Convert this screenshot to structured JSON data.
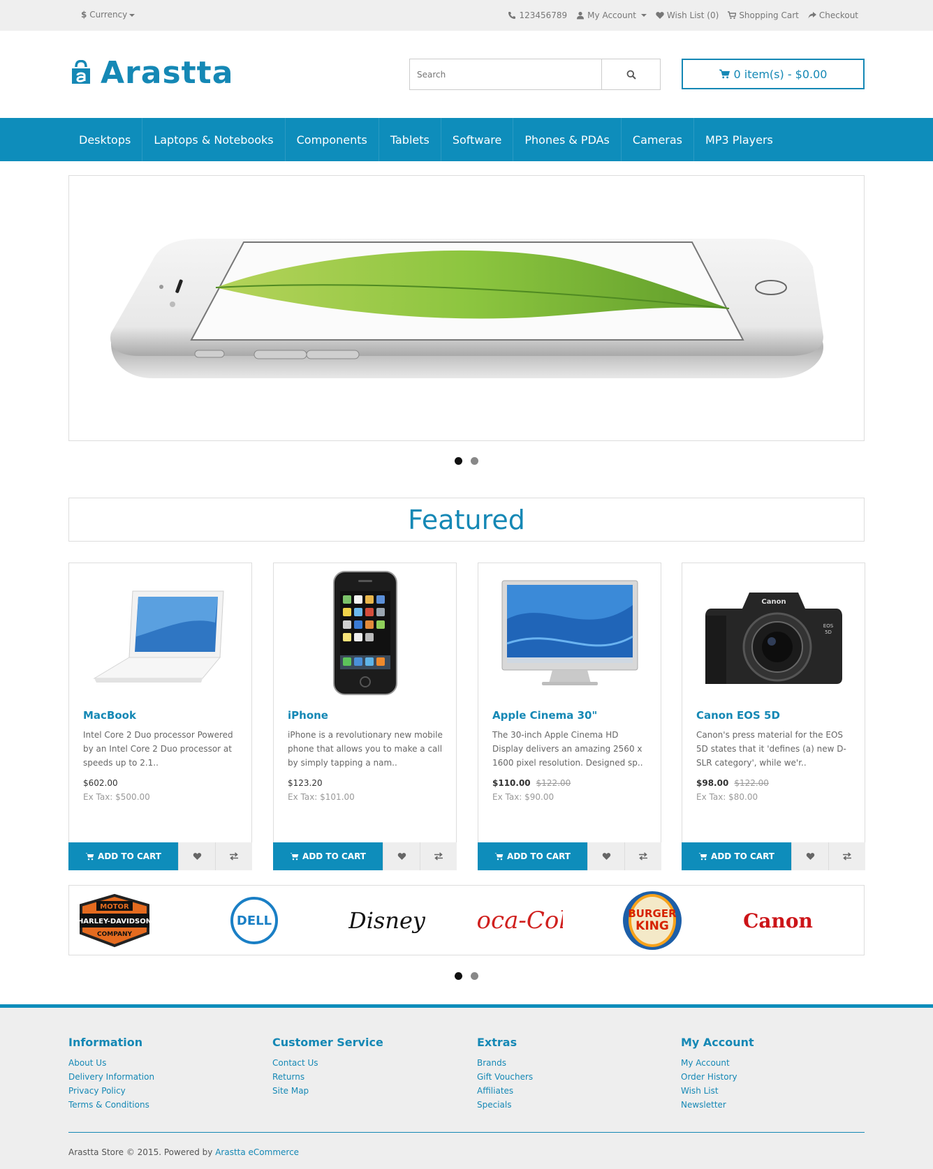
{
  "topbar": {
    "currency_symbol": "$",
    "currency_label": "Currency",
    "phone": "123456789",
    "my_account": "My Account",
    "wish_list": "Wish List (0)",
    "shopping_cart": "Shopping Cart",
    "checkout": "Checkout"
  },
  "header": {
    "logo_text": "Arastta",
    "search_placeholder": "Search",
    "cart_summary": "0 item(s) - $0.00"
  },
  "nav": {
    "items": [
      "Desktops",
      "Laptops & Notebooks",
      "Components",
      "Tablets",
      "Software",
      "Phones & PDAs",
      "Cameras",
      "MP3 Players"
    ]
  },
  "slider": {
    "slide_count": 2,
    "active_index": 0
  },
  "featured": {
    "title": "Featured",
    "products": [
      {
        "name": "MacBook",
        "description": "Intel Core 2 Duo processor Powered by an Intel Core 2 Duo processor at speeds up to 2.1..",
        "price": "$602.00",
        "old_price": "",
        "tax": "Ex Tax: $500.00",
        "add_to_cart": "ADD TO CART"
      },
      {
        "name": "iPhone",
        "description": "iPhone is a revolutionary new mobile phone that allows you to make a call by simply tapping a nam..",
        "price": "$123.20",
        "old_price": "",
        "tax": "Ex Tax: $101.00",
        "add_to_cart": "ADD TO CART"
      },
      {
        "name": "Apple Cinema 30\"",
        "description": "The 30-inch Apple Cinema HD Display delivers an amazing 2560 x 1600 pixel resolution. Designed sp..",
        "price": "$110.00",
        "old_price": "$122.00",
        "tax": "Ex Tax: $90.00",
        "add_to_cart": "ADD TO CART"
      },
      {
        "name": "Canon EOS 5D",
        "description": "Canon's press material for the EOS 5D states that it 'defines (a) new D-SLR category', while we'r..",
        "price": "$98.00",
        "old_price": "$122.00",
        "tax": "Ex Tax: $80.00",
        "add_to_cart": "ADD TO CART"
      }
    ]
  },
  "brands": {
    "items": [
      "HARLEY-DAVIDSON",
      "DELL",
      "Disney",
      "Coca-Cola",
      "BURGER KING",
      "Canon"
    ],
    "slide_count": 2,
    "active_index": 0
  },
  "footer": {
    "columns": [
      {
        "title": "Information",
        "links": [
          "About Us",
          "Delivery Information",
          "Privacy Policy",
          "Terms & Conditions"
        ]
      },
      {
        "title": "Customer Service",
        "links": [
          "Contact Us",
          "Returns",
          "Site Map"
        ]
      },
      {
        "title": "Extras",
        "links": [
          "Brands",
          "Gift Vouchers",
          "Affiliates",
          "Specials"
        ]
      },
      {
        "title": "My Account",
        "links": [
          "My Account",
          "Order History",
          "Wish List",
          "Newsletter"
        ]
      }
    ],
    "copyright": "Arastta Store © 2015. Powered by",
    "powered_by": "Arastta eCommerce"
  },
  "colors": {
    "accent": "#0e8dbb",
    "link": "#1588b5",
    "topbar_bg": "#efefef",
    "footer_bg": "#eeeeee"
  },
  "icons": [
    "phone-icon",
    "user-icon",
    "heart-icon",
    "cart-icon",
    "share-icon",
    "search-icon",
    "compare-icon"
  ]
}
